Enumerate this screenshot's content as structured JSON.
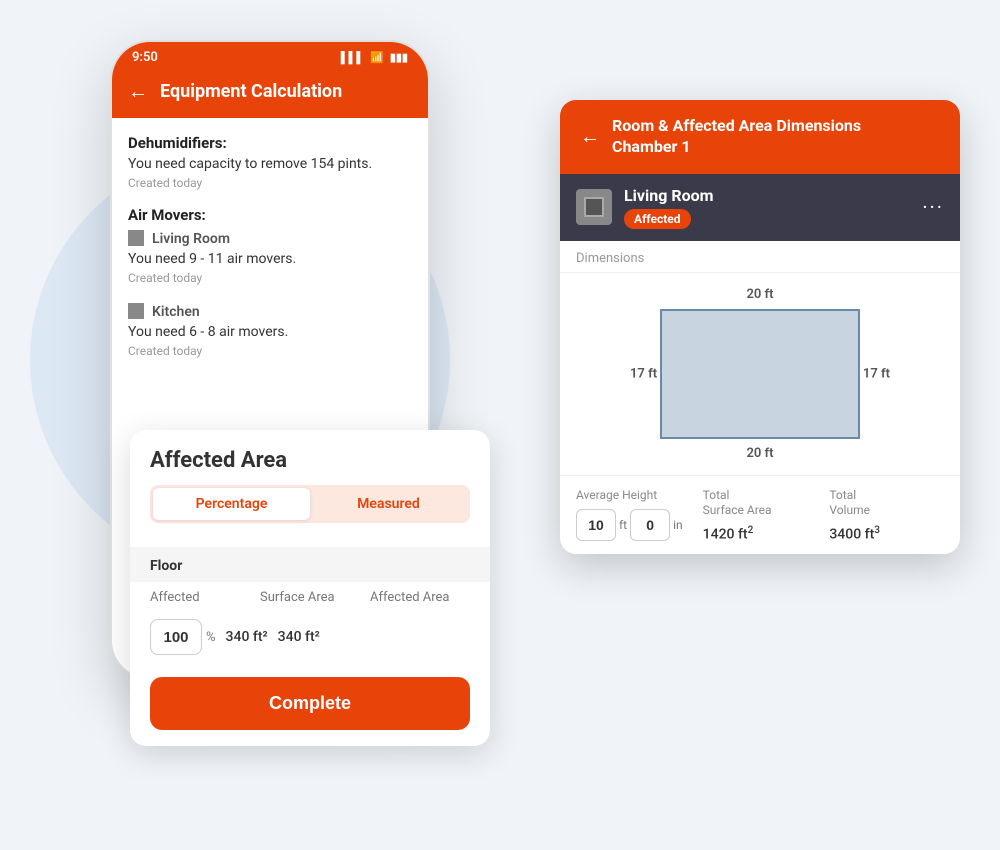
{
  "background": {
    "circle_color": "#dde8f5"
  },
  "phone": {
    "status_bar": {
      "time": "9:50",
      "signal": "▌▌▌",
      "wifi": "WiFi",
      "battery": "🔋"
    },
    "header": {
      "back_label": "←",
      "title": "Equipment Calculation"
    },
    "content": {
      "dehumidifiers_label": "Dehumidifiers:",
      "dehumidifiers_text": "You need capacity to remove 154 pints.",
      "dehumidifiers_date": "Created today",
      "air_movers_label": "Air Movers:",
      "room1_name": "Living Room",
      "room1_text": "You need 9 - 11 air movers.",
      "room1_date": "Created today",
      "room2_name": "Kitchen",
      "room2_text": "You need 6 - 8 air movers.",
      "room2_date": "Created today"
    }
  },
  "affected_area_card": {
    "title": "Affected Area",
    "tab_percentage": "Percentage",
    "tab_measured": "Measured",
    "floor_label": "Floor",
    "col_affected": "Affected",
    "col_surface_area": "Surface Area",
    "col_affected_area": "Affected Area",
    "affected_value": "100",
    "affected_unit": "%",
    "surface_area_value": "340 ft²",
    "affected_area_value": "340 ft²",
    "complete_button": "Complete"
  },
  "dimensions_card": {
    "header": {
      "back_label": "←",
      "title_line1": "Room & Affected Area Dimensions",
      "title_line2": "Chamber 1"
    },
    "room": {
      "name": "Living Room",
      "status": "Affected"
    },
    "dimensions_label": "Dimensions",
    "diagram": {
      "top": "20 ft",
      "bottom": "20 ft",
      "left": "17 ft",
      "right": "17 ft"
    },
    "stats": {
      "avg_height_label": "Average Height",
      "avg_height_ft": "10",
      "avg_height_in": "0",
      "total_surface_label": "Total\nSurface Area",
      "total_surface_value": "1420 ft²",
      "total_volume_label": "Total\nVolume",
      "total_volume_value": "3400 ft³"
    }
  }
}
